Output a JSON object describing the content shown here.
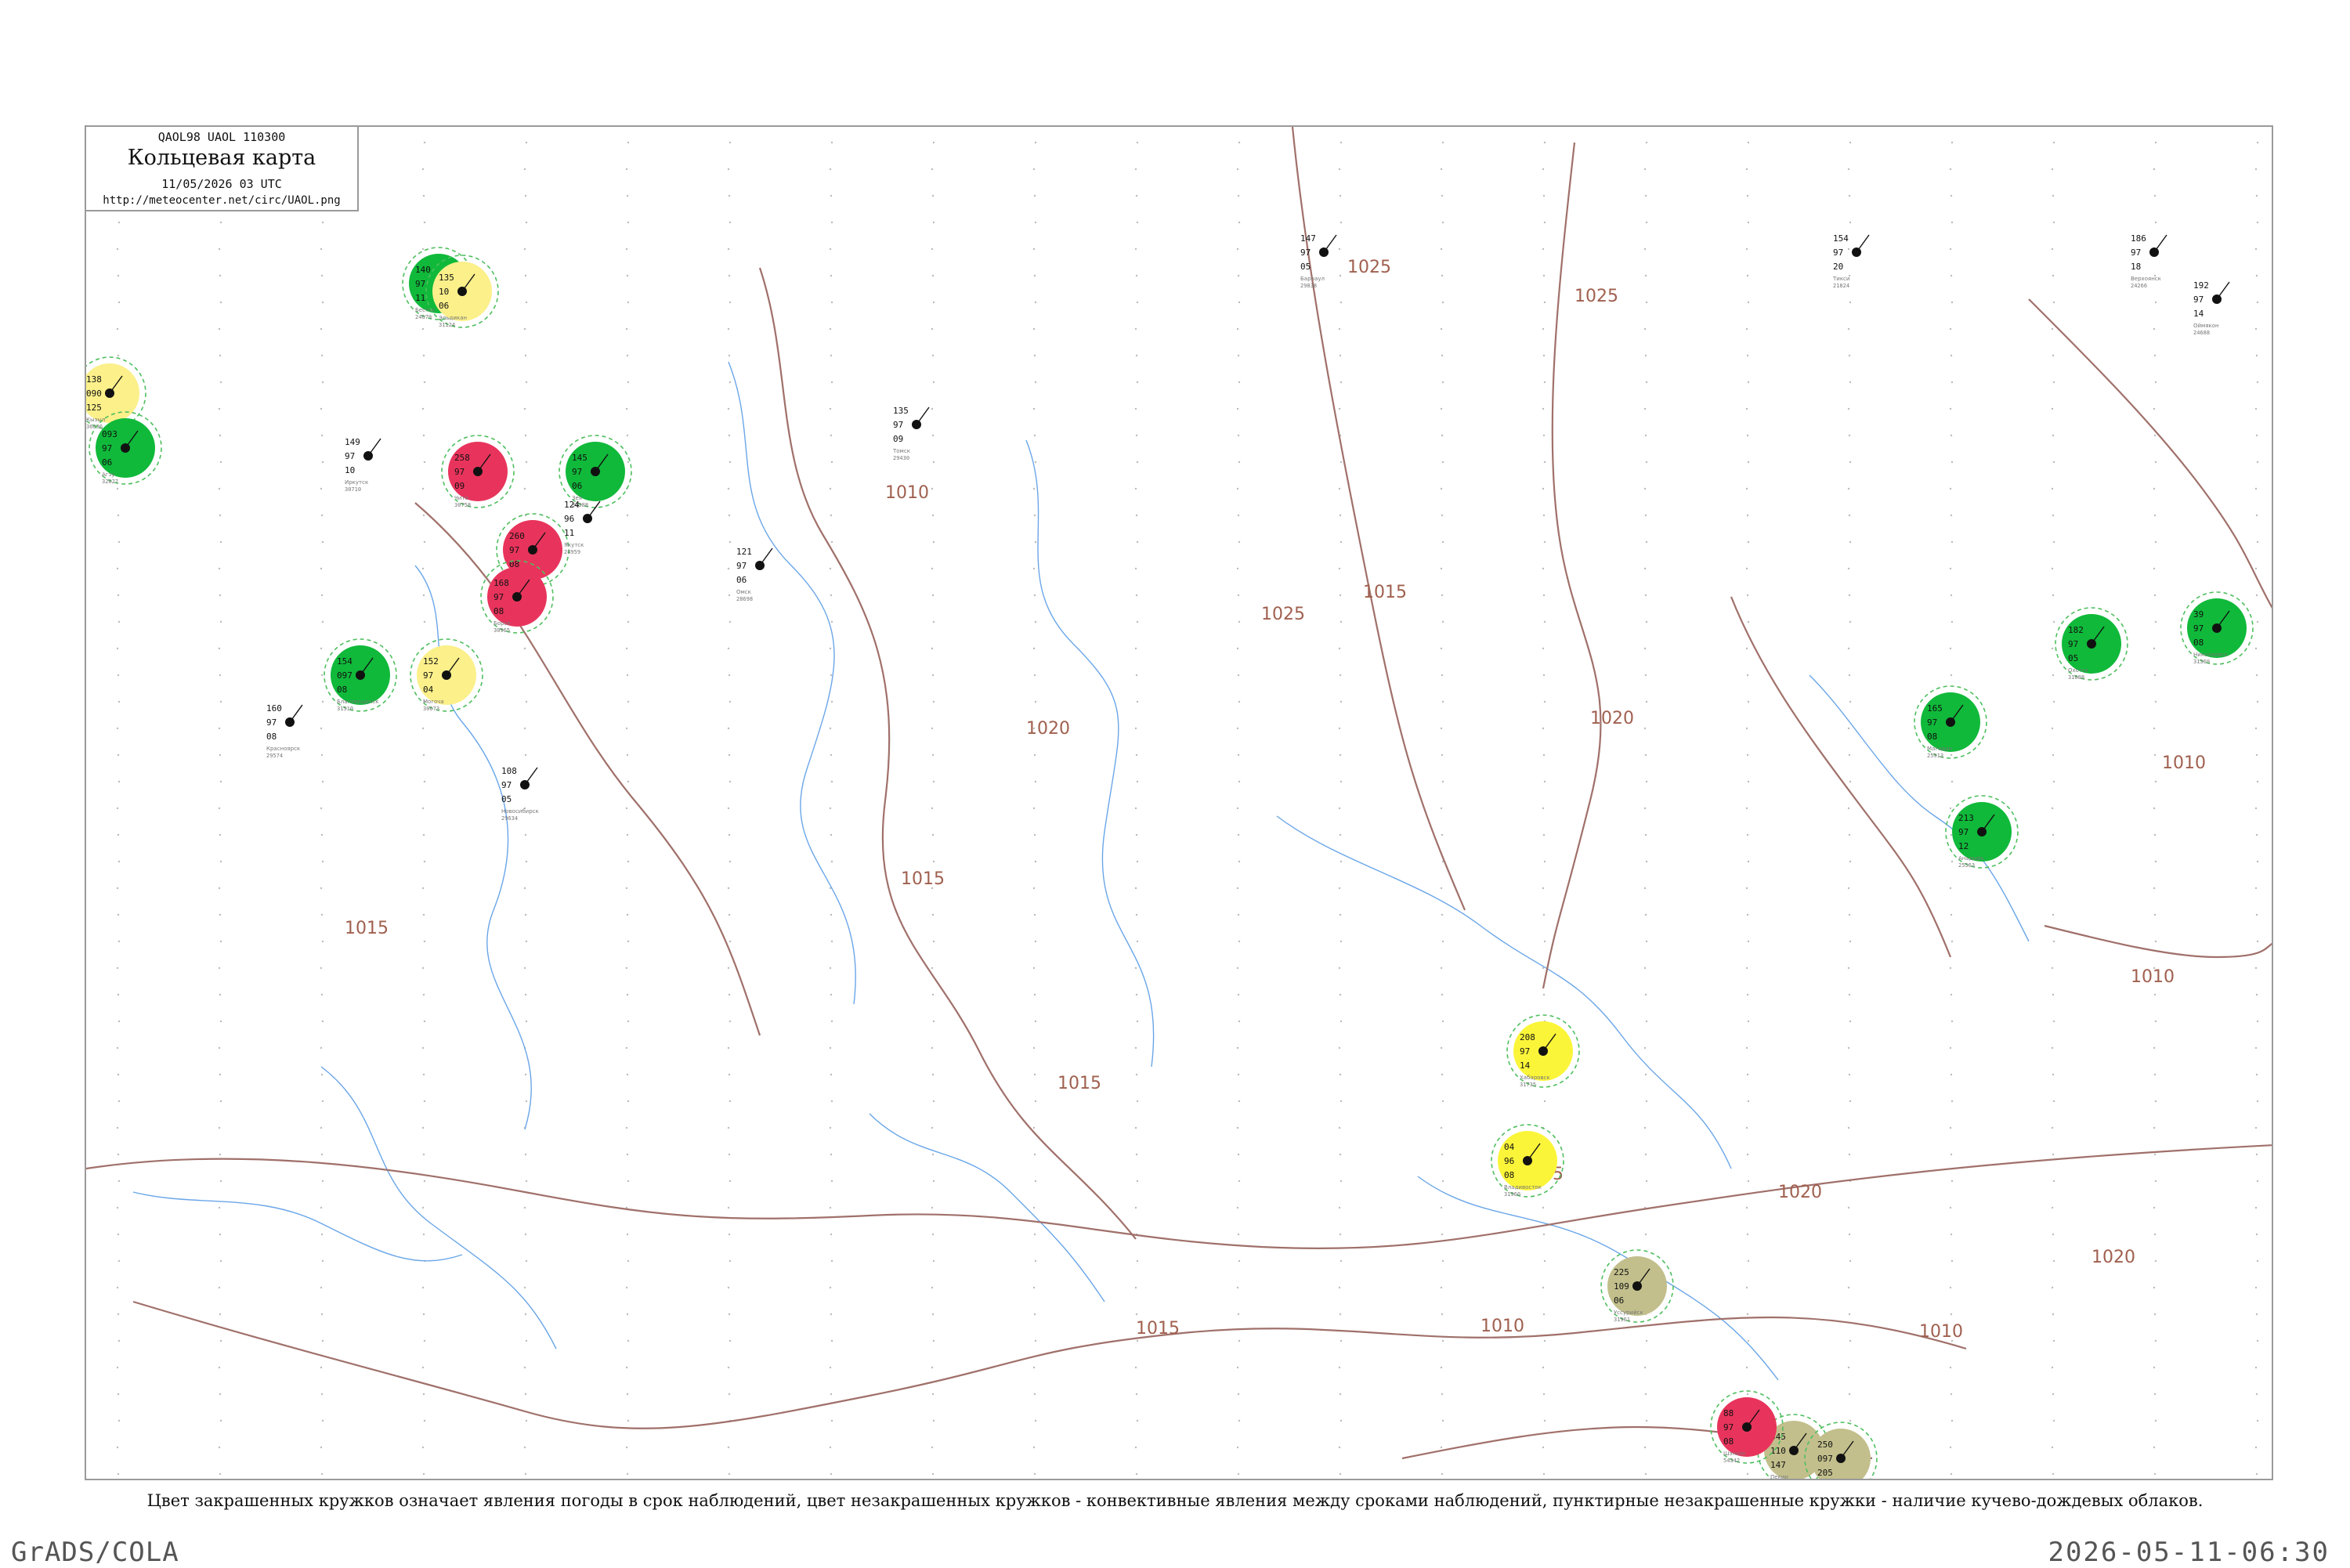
{
  "header": {
    "codes": "QAOL98  UAOL  110300",
    "title": "Кольцевая карта",
    "datetime": "11/05/2026 03 UTC",
    "url": "http://meteocenter.net/circ/UAOL.png"
  },
  "caption": "Цвет закрашенных кружков означает явления погоды в срок наблюдений, цвет незакрашенных кружков - конвективные явления между сроками наблюдений, пунктирные незакрашенные кружки - наличие кучево-дождевых облаков.",
  "footer": {
    "left": "GrADS/COLA",
    "right": "2026-05-11-06:30"
  },
  "colors": {
    "isobar": "#a0706a",
    "river": "#6aa6e8",
    "shower_green": "#10b93a",
    "thunder_red": "#e8345c",
    "fog_yellow": "#fbf08a",
    "bright_yellow": "#fbf53a",
    "dust_olive": "#c2bf8c",
    "cb_dashed_green": "#4fbf5f"
  },
  "isobar_labels": [
    "1015",
    "1015",
    "1010",
    "1015",
    "1015",
    "1020",
    "1020",
    "1025",
    "1025",
    "1025",
    "1020",
    "1020",
    "1015",
    "1015",
    "1010",
    "1010",
    "1010",
    "1010"
  ],
  "stations": [
    {
      "name": "Бестях",
      "index": "24679",
      "values": [
        "140",
        "97",
        "11"
      ],
      "wx": "shower"
    },
    {
      "name": "Эльдикан",
      "index": "31124",
      "values": [
        "135",
        "10",
        "06"
      ],
      "wx": "fog"
    },
    {
      "name": "Кызыл",
      "index": "36096",
      "values": [
        "138",
        "090",
        "125"
      ],
      "wx": "fog"
    },
    {
      "name": "Агзу",
      "index": "32027",
      "values": [
        "093",
        "97",
        "06"
      ],
      "wx": "shower"
    },
    {
      "name": "Чита",
      "index": "30758",
      "values": [
        "258",
        "97",
        "09"
      ],
      "wx": "thunder"
    },
    {
      "name": "Нерчинск",
      "index": "30859",
      "values": [
        "260",
        "97",
        "08"
      ],
      "wx": "thunder"
    },
    {
      "name": "Борзя",
      "index": "30965",
      "values": [
        "168",
        "97",
        "08"
      ],
      "wx": "thunder"
    },
    {
      "name": "Могоча",
      "index": "30673",
      "values": [
        "152",
        "97",
        "04"
      ],
      "wx": "fog"
    },
    {
      "name": "Зея",
      "index": "31388",
      "values": [
        "145",
        "97",
        "06"
      ],
      "wx": "shower"
    },
    {
      "name": "Благовещенск",
      "index": "31510",
      "values": [
        "154",
        "097",
        "08"
      ],
      "wx": "shower"
    },
    {
      "name": "Хабаровск",
      "index": "31735",
      "values": [
        "208",
        "97",
        "14"
      ],
      "wx": "brightyellow"
    },
    {
      "name": "Владивосток",
      "index": "31960",
      "values": [
        "04",
        "96",
        "08"
      ],
      "wx": "brightyellow"
    },
    {
      "name": "Уссурийск",
      "index": "31961",
      "values": [
        "225",
        "109",
        "06"
      ],
      "wx": "dust"
    },
    {
      "name": "Пекин",
      "index": "54511",
      "values": [
        "345",
        "110",
        "147"
      ],
      "wx": "dust"
    },
    {
      "name": "Тяньцзинь",
      "index": "54527",
      "values": [
        "250",
        "097",
        "205"
      ],
      "wx": "dust"
    },
    {
      "name": "Шэньян",
      "index": "54342",
      "values": [
        "88",
        "97",
        "08"
      ],
      "wx": "thunder"
    },
    {
      "name": "Николаевск",
      "index": "31369",
      "values": [
        "39",
        "97",
        "08"
      ],
      "wx": "shower"
    },
    {
      "name": "Охотск",
      "index": "31088",
      "values": [
        "182",
        "97",
        "05"
      ],
      "wx": "shower"
    },
    {
      "name": "Магадан",
      "index": "25913",
      "values": [
        "165",
        "97",
        "08"
      ],
      "wx": "shower"
    },
    {
      "name": "Анадырь",
      "index": "25563",
      "values": [
        "213",
        "97",
        "12"
      ],
      "wx": "shower"
    },
    {
      "name": "Якутск",
      "index": "24959",
      "values": [
        "124",
        "96",
        "11"
      ],
      "wx": "plain"
    },
    {
      "name": "Иркутск",
      "index": "30710",
      "values": [
        "149",
        "97",
        "10"
      ],
      "wx": "plain"
    },
    {
      "name": "Красноярск",
      "index": "29574",
      "values": [
        "160",
        "97",
        "08"
      ],
      "wx": "plain"
    },
    {
      "name": "Новосибирск",
      "index": "29634",
      "values": [
        "108",
        "97",
        "05"
      ],
      "wx": "plain"
    },
    {
      "name": "Омск",
      "index": "28698",
      "values": [
        "121",
        "97",
        "06"
      ],
      "wx": "plain"
    },
    {
      "name": "Томск",
      "index": "29430",
      "values": [
        "135",
        "97",
        "09"
      ],
      "wx": "plain"
    },
    {
      "name": "Барнаул",
      "index": "29838",
      "values": [
        "147",
        "97",
        "05"
      ],
      "wx": "plain"
    },
    {
      "name": "Тикси",
      "index": "21824",
      "values": [
        "154",
        "97",
        "20"
      ],
      "wx": "plain"
    },
    {
      "name": "Верхоянск",
      "index": "24266",
      "values": [
        "186",
        "97",
        "18"
      ],
      "wx": "plain"
    },
    {
      "name": "Оймякон",
      "index": "24688",
      "values": [
        "192",
        "97",
        "14"
      ],
      "wx": "plain"
    }
  ]
}
